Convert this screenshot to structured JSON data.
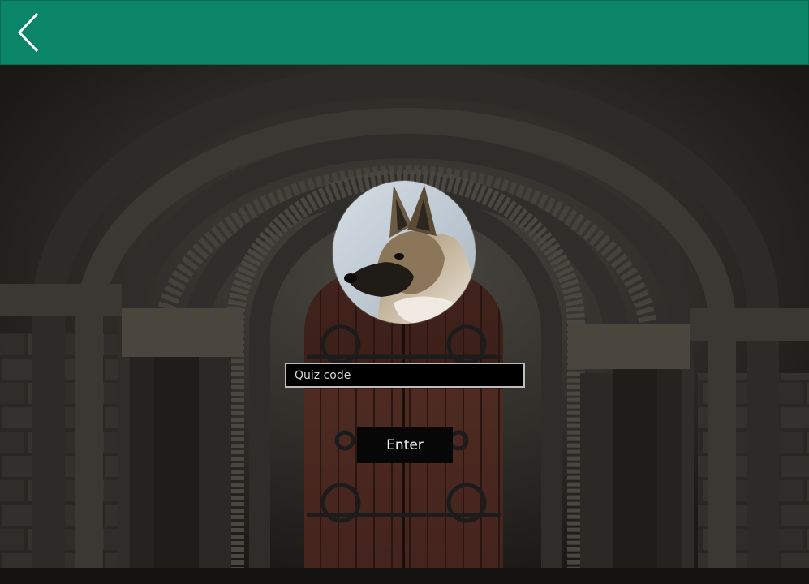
{
  "header": {
    "back_icon": "chevron-left-icon",
    "color": "#0b8567"
  },
  "background": {
    "description_icon": "stone-archway-door-image"
  },
  "profile": {
    "avatar_icon": "dog-portrait-image"
  },
  "quiz_form": {
    "input_value": "",
    "input_placeholder": "Quiz code",
    "submit_label": "Enter"
  }
}
